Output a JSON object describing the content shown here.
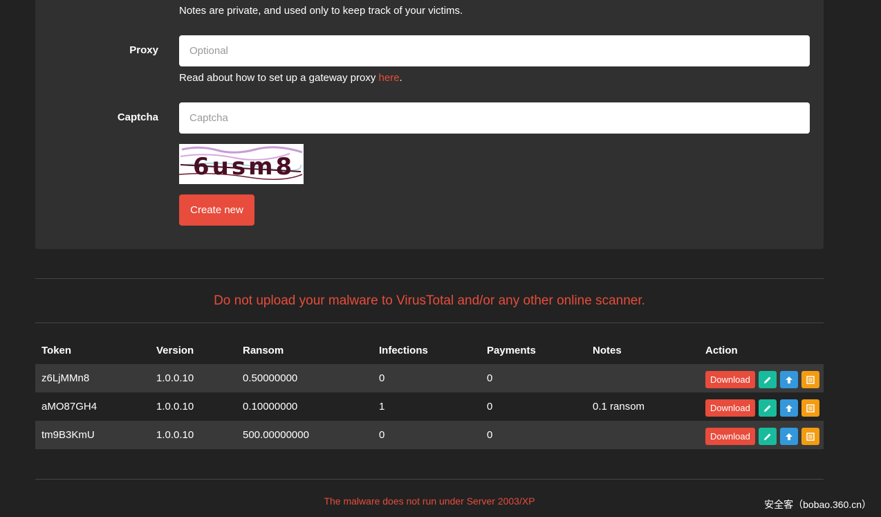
{
  "form": {
    "notes_help": "Notes are private, and used only to keep track of your victims.",
    "proxy_label": "Proxy",
    "proxy_placeholder": "Optional",
    "proxy_help_prefix": "Read about how to set up a gateway proxy ",
    "proxy_help_link": "here",
    "proxy_help_suffix": ".",
    "captcha_label": "Captcha",
    "captcha_placeholder": "Captcha",
    "captcha_text": "6usm8",
    "create_button": "Create new"
  },
  "warning": "Do not upload your malware to VirusTotal and/or any other online scanner.",
  "table": {
    "headers": [
      "Token",
      "Version",
      "Ransom",
      "Infections",
      "Payments",
      "Notes",
      "Action"
    ],
    "rows": [
      {
        "token": "z6LjMMn8",
        "version": "1.0.0.10",
        "ransom": "0.50000000",
        "infections": "0",
        "payments": "0",
        "notes": ""
      },
      {
        "token": "aMO87GH4",
        "version": "1.0.0.10",
        "ransom": "0.10000000",
        "infections": "1",
        "payments": "0",
        "notes": "0.1 ransom"
      },
      {
        "token": "tm9B3KmU",
        "version": "1.0.0.10",
        "ransom": "500.00000000",
        "infections": "0",
        "payments": "0",
        "notes": ""
      }
    ],
    "download_label": "Download"
  },
  "footer_note": "The malware does not run under Server 2003/XP",
  "watermark": "安全客（bobao.360.cn）",
  "colors": {
    "accent_red": "#e74c3c",
    "green": "#18bc9c",
    "blue": "#3498db",
    "orange": "#f39c12"
  }
}
